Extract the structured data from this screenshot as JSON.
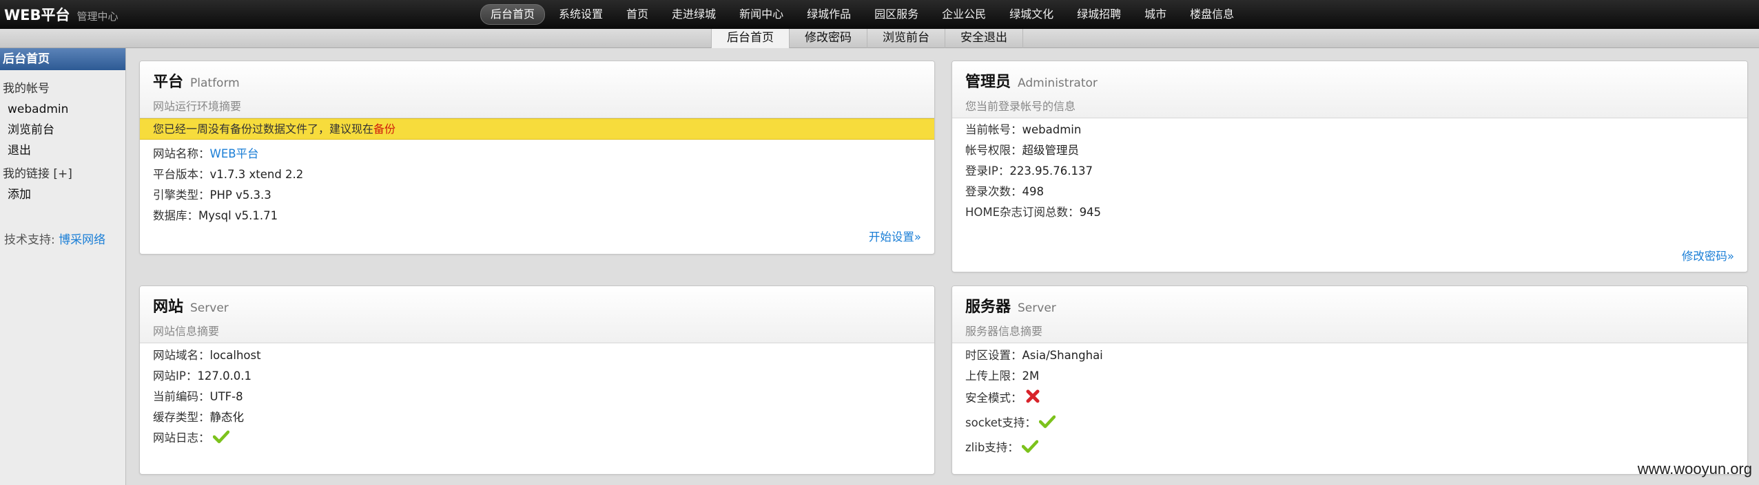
{
  "brand": {
    "name": "WEB平台",
    "subtitle": "管理中心"
  },
  "main_nav": [
    "后台首页",
    "系统设置",
    "首页",
    "走进绿城",
    "新闻中心",
    "绿城作品",
    "园区服务",
    "企业公民",
    "绿城文化",
    "绿城招聘",
    "城市",
    "楼盘信息"
  ],
  "sub_nav": [
    "后台首页",
    "修改密码",
    "浏览前台",
    "安全退出"
  ],
  "sidebar": {
    "header": "后台首页",
    "account_title": "我的帐号",
    "username": "webadmin",
    "browse": "浏览前台",
    "logout": "退出",
    "links_title": "我的链接 [+]",
    "add": "添加",
    "support_label": "技术支持:",
    "support_link": "博采网络"
  },
  "platform": {
    "title": "平台",
    "title_en": "Platform",
    "subtitle": "网站运行环境摘要",
    "notice_text": "您已经一周没有备份过数据文件了，建议现在",
    "notice_link": "备份",
    "rows": [
      {
        "label": "网站名称：",
        "value": "WEB平台"
      },
      {
        "label": "平台版本：",
        "value": "v1.7.3 xtend 2.2"
      },
      {
        "label": "引擎类型：",
        "value": "PHP v5.3.3"
      },
      {
        "label": "数据库：",
        "value": "Mysql v5.1.71"
      }
    ],
    "link": "开始设置»"
  },
  "admin": {
    "title": "管理员",
    "title_en": "Administrator",
    "subtitle": "您当前登录帐号的信息",
    "rows": [
      {
        "label": "当前帐号：",
        "value": "webadmin"
      },
      {
        "label": "帐号权限：",
        "value": "超级管理员"
      },
      {
        "label": "登录IP：",
        "value": "223.95.76.137"
      },
      {
        "label": "登录次数：",
        "value": "498"
      },
      {
        "label": "HOME杂志订阅总数：",
        "value": "945"
      }
    ],
    "link": "修改密码»"
  },
  "website": {
    "title": "网站",
    "title_en": "Server",
    "subtitle": "网站信息摘要",
    "rows": [
      {
        "label": "网站域名：",
        "value": "localhost"
      },
      {
        "label": "网站IP：",
        "value": "127.0.0.1"
      },
      {
        "label": "当前编码：",
        "value": "UTF-8"
      },
      {
        "label": "缓存类型：",
        "value": "静态化"
      },
      {
        "label": "网站日志：",
        "icon": "check-icon"
      }
    ]
  },
  "server": {
    "title": "服务器",
    "title_en": "Server",
    "subtitle": "服务器信息摘要",
    "rows": [
      {
        "label": "时区设置：",
        "value": "Asia/Shanghai"
      },
      {
        "label": "上传上限：",
        "value": "2M"
      },
      {
        "label": "安全模式：",
        "icon": "cross-icon"
      },
      {
        "label": "socket支持：",
        "icon": "check-icon"
      },
      {
        "label": "zlib支持：",
        "icon": "check-icon"
      }
    ]
  },
  "watermark": "www.wooyun.org",
  "colors": {
    "link": "#1a7ed6",
    "notice_bg": "#f7dc3c",
    "sidebar_head": "#3d6aa6",
    "check": "#7cc21c",
    "cross": "#d8232a"
  }
}
